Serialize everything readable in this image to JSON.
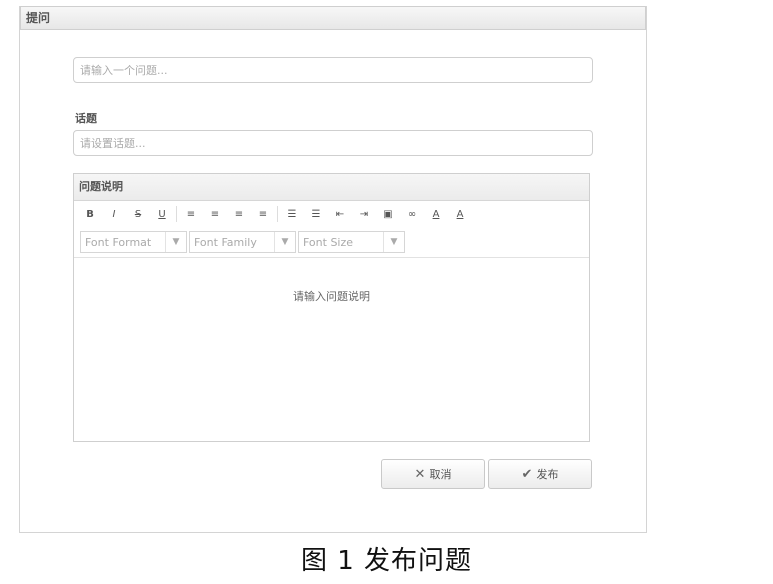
{
  "header": {
    "title": "提问"
  },
  "question": {
    "placeholder": "请输入一个问题..."
  },
  "topic": {
    "label": "话题",
    "placeholder": "请设置话题..."
  },
  "editor": {
    "title": "问题说明",
    "toolbar": [
      {
        "name": "bold-icon",
        "glyph": "B"
      },
      {
        "name": "italic-icon",
        "glyph": "I"
      },
      {
        "name": "strikethrough-icon",
        "glyph": "S"
      },
      {
        "name": "underline-icon",
        "glyph": "U"
      },
      {
        "name": "align-left-icon",
        "glyph": "≡"
      },
      {
        "name": "align-center-icon",
        "glyph": "≡"
      },
      {
        "name": "align-right-icon",
        "glyph": "≡"
      },
      {
        "name": "align-justify-icon",
        "glyph": "≡"
      },
      {
        "name": "ordered-list-icon",
        "glyph": "☰"
      },
      {
        "name": "unordered-list-icon",
        "glyph": "☰"
      },
      {
        "name": "outdent-icon",
        "glyph": "⇤"
      },
      {
        "name": "indent-icon",
        "glyph": "⇥"
      },
      {
        "name": "image-icon",
        "glyph": "▣"
      },
      {
        "name": "link-icon",
        "glyph": "∞"
      },
      {
        "name": "font-color-icon",
        "glyph": "A"
      },
      {
        "name": "background-color-icon",
        "glyph": "A"
      }
    ],
    "font_format": "Font Format",
    "font_family": "Font Family",
    "font_size": "Font Size",
    "body_placeholder": "请输入问题说明"
  },
  "actions": {
    "cancel_label": "取消",
    "publish_label": "发布"
  },
  "caption": "图 1   发布问题"
}
